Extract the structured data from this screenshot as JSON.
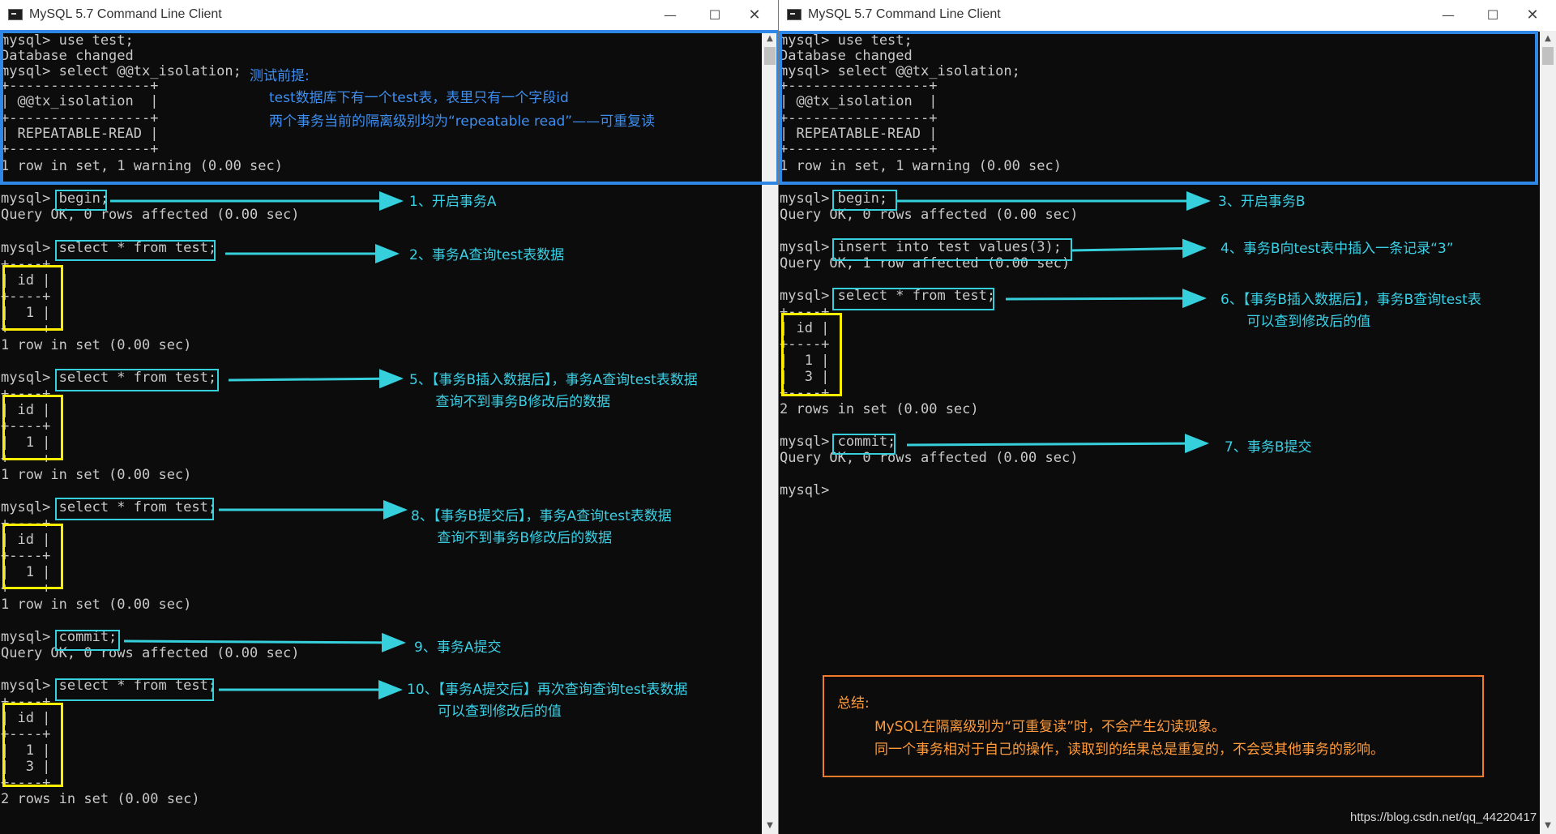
{
  "windowA": {
    "title": "MySQL 5.7 Command Line Client",
    "controls": {
      "minimize": "—",
      "maximize": "☐",
      "close": "✕"
    },
    "lines": [
      "mysql> use test;",
      "Database changed",
      "mysql> select @@tx_isolation;",
      "+-----------------+",
      "| @@tx_isolation  |",
      "+-----------------+",
      "| REPEATABLE-READ |",
      "+-----------------+",
      "1 row in set, 1 warning (0.00 sec)",
      "",
      "mysql> begin;",
      "Query OK, 0 rows affected (0.00 sec)",
      "",
      "mysql> select * from test;",
      "+----+",
      "| id |",
      "+----+",
      "|  1 |",
      "+----+",
      "1 row in set (0.00 sec)",
      "",
      "mysql> select * from test;",
      "+----+",
      "| id |",
      "+----+",
      "|  1 |",
      "+----+",
      "1 row in set (0.00 sec)",
      "",
      "",
      "mysql> select * from test;",
      "+----+",
      "| id |",
      "+----+",
      "|  1 |",
      "+----+",
      "1 row in set (0.00 sec)",
      "",
      "mysql> commit;",
      "Query OK, 0 rows affected (0.00 sec)",
      "",
      "mysql> select * from test;",
      "+----+",
      "| id |",
      "+----+",
      "|  1 |",
      "|  3 |",
      "+----+",
      "2 rows in set (0.00 sec)"
    ],
    "premise_title": "测试前提:",
    "premise_lines": [
      "test数据库下有一个test表，表里只有一个字段id",
      "两个事务当前的隔离级别均为“repeatable read”——可重复读"
    ],
    "annotations": [
      "1、开启事务A",
      "2、事务A查询test表数据",
      "5、【事务B插入数据后】，事务A查询test表数据\n      查询不到事务B修改后的数据",
      "8、【事务B提交后】，事务A查询test表数据\n      查询不到事务B修改后的数据",
      "9、事务A提交",
      "10、【事务A提交后】再次查询查询test表数据\n       可以查到修改后的值"
    ]
  },
  "windowB": {
    "title": "MySQL 5.7 Command Line Client",
    "controls": {
      "minimize": "—",
      "maximize": "☐",
      "close": "✕"
    },
    "lines": [
      "mysql> use test;",
      "Database changed",
      "mysql> select @@tx_isolation;",
      "+-----------------+",
      "| @@tx_isolation  |",
      "+-----------------+",
      "| REPEATABLE-READ |",
      "+-----------------+",
      "1 row in set, 1 warning (0.00 sec)",
      "",
      "mysql> begin;",
      "Query OK, 0 rows affected (0.00 sec)",
      "",
      "mysql> insert into test values(3);",
      "Query OK, 1 row affected (0.00 sec)",
      "",
      "mysql> select * from test;",
      "+----+",
      "| id |",
      "+----+",
      "|  1 |",
      "|  3 |",
      "+----+",
      "2 rows in set (0.00 sec)",
      "",
      "mysql> commit;",
      "Query OK, 0 rows affected (0.00 sec)",
      "",
      "mysql>"
    ],
    "annotations": [
      "3、开启事务B",
      "4、事务B向test表中插入一条记录“3”",
      "6、【事务B插入数据后】，事务B查询test表\n      可以查到修改后的值",
      "7、事务B提交"
    ],
    "summary": {
      "title": "总结:",
      "lines": [
        "MySQL在隔离级别为“可重复读”时，不会产生幻读现象。",
        "同一个事务相对于自己的操作，读取到的结果总是重复的，不会受其他事务的影响。"
      ]
    }
  },
  "watermark": "https://blog.csdn.net/qq_44220417",
  "colors": {
    "terminal_bg": "#0c0c0c",
    "terminal_text": "#c8c8c8",
    "cyan": "#35d0dc",
    "yellow": "#ffee00",
    "blue": "#2f88e6",
    "orange": "#f07b2b"
  }
}
